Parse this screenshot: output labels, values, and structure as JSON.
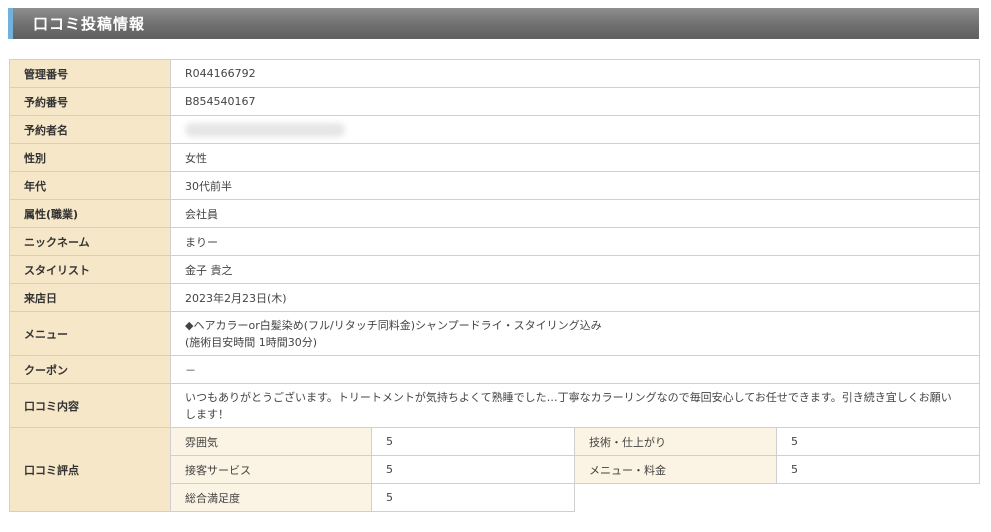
{
  "header": {
    "title": "口コミ投稿情報"
  },
  "rows": {
    "management_no": {
      "label": "管理番号",
      "value": "R044166792"
    },
    "reservation_no": {
      "label": "予約番号",
      "value": "B854540167"
    },
    "reserver_name": {
      "label": "予約者名",
      "value": ""
    },
    "gender": {
      "label": "性別",
      "value": "女性"
    },
    "age": {
      "label": "年代",
      "value": "30代前半"
    },
    "occupation": {
      "label": "属性(職業)",
      "value": "会社員"
    },
    "nickname": {
      "label": "ニックネーム",
      "value": "まりー"
    },
    "stylist": {
      "label": "スタイリスト",
      "value": "金子 貴之"
    },
    "visit_date": {
      "label": "来店日",
      "value": "2023年2月23日(木)"
    },
    "menu": {
      "label": "メニュー",
      "line1": "◆ヘアカラーor白髪染め(フル/リタッチ同料金)シャンプードライ・スタイリング込み",
      "line2": "(施術目安時間 1時間30分)"
    },
    "coupon": {
      "label": "クーポン",
      "value": "－"
    },
    "review": {
      "label": "口コミ内容",
      "value": "いつもありがとうございます。トリートメントが気持ちよくて熟睡でした…丁寧なカラーリングなので毎回安心してお任せできます。引き続き宜しくお願いします！"
    },
    "rating": {
      "label": "口コミ評点",
      "atmosphere": {
        "label": "雰囲気",
        "value": "5"
      },
      "technique": {
        "label": "技術・仕上がり",
        "value": "5"
      },
      "service": {
        "label": "接客サービス",
        "value": "5"
      },
      "menu_price": {
        "label": "メニュー・料金",
        "value": "5"
      },
      "overall": {
        "label": "総合満足度",
        "value": "5"
      }
    }
  }
}
